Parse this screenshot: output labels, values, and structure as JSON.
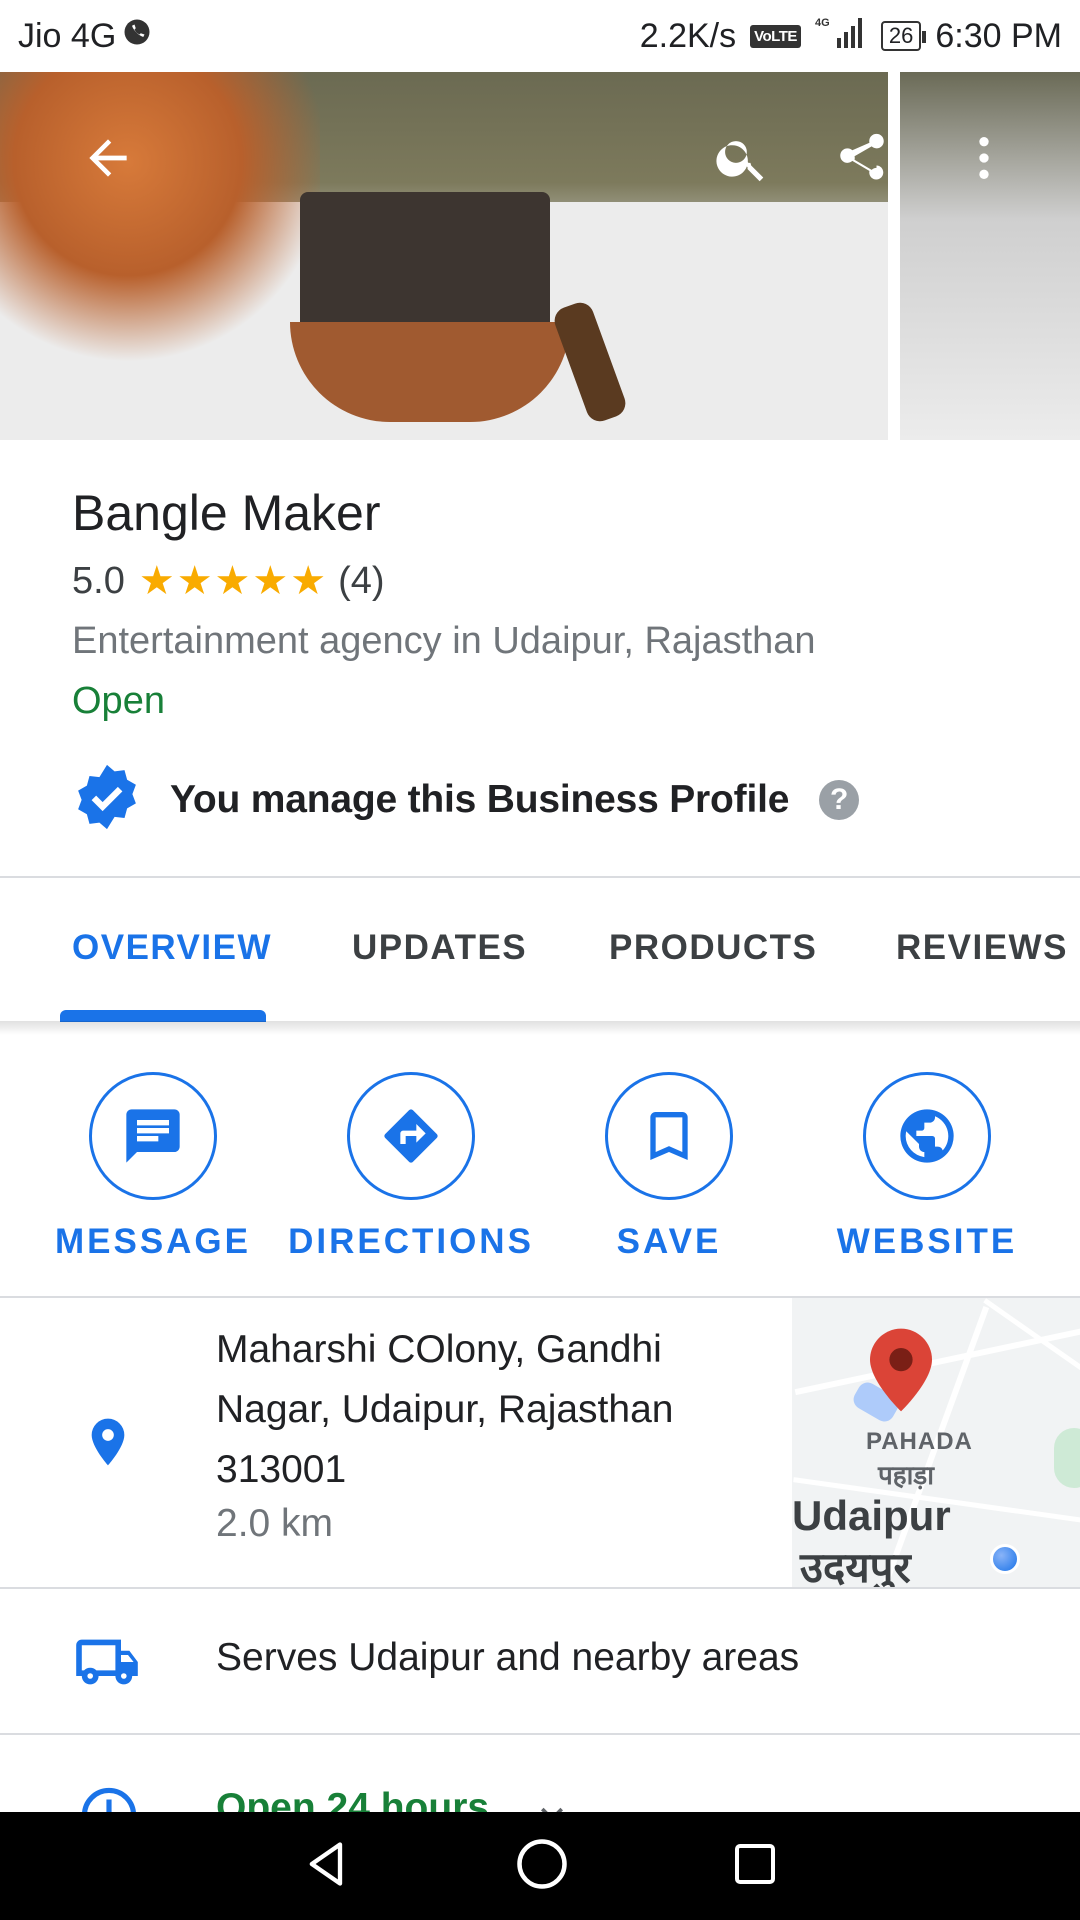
{
  "status_bar": {
    "carrier": "Jio 4G",
    "speed": "2.2K/s",
    "volte": "VoLTE",
    "network": "4G",
    "battery": "26",
    "time": "6:30 PM"
  },
  "place": {
    "title": "Bangle Maker",
    "rating": "5.0",
    "stars": "★★★★★",
    "review_count": "(4)",
    "category": "Entertainment agency in Udaipur, Rajasthan",
    "status": "Open",
    "manage_text": "You manage this Business Profile",
    "help_symbol": "?"
  },
  "tabs": [
    {
      "label": "OVERVIEW",
      "active": true
    },
    {
      "label": "UPDATES",
      "active": false
    },
    {
      "label": "PRODUCTS",
      "active": false
    },
    {
      "label": "REVIEWS",
      "active": false
    }
  ],
  "actions": [
    {
      "label": "MESSAGE",
      "icon": "message-icon"
    },
    {
      "label": "DIRECTIONS",
      "icon": "directions-icon"
    },
    {
      "label": "SAVE",
      "icon": "bookmark-icon"
    },
    {
      "label": "WEBSITE",
      "icon": "globe-icon"
    }
  ],
  "address": {
    "line": "Maharshi COlony, Gandhi Nagar, Udaipur, Rajasthan 313001",
    "distance": "2.0 km"
  },
  "map": {
    "area_label_en": "PAHADA",
    "area_label_hi": "पहाड़ा",
    "city_en": "Udaipur",
    "city_hi": "उदयपुर"
  },
  "serves": {
    "text": "Serves Udaipur and nearby areas"
  },
  "hours": {
    "text": "Open 24 hours"
  },
  "colors": {
    "accent": "#1a73e8",
    "open_green": "#188038",
    "star": "#f9ab00"
  }
}
